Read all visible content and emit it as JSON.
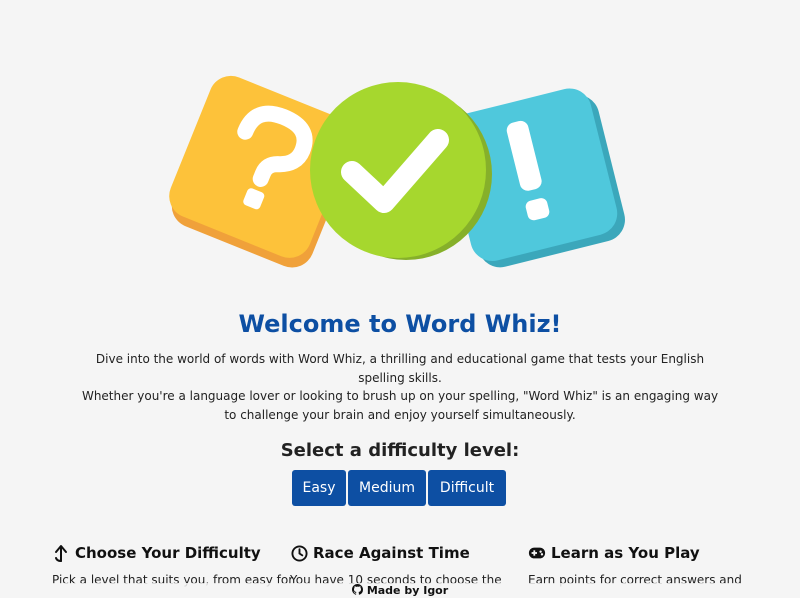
{
  "hero": {
    "icons": [
      "question-mark-icon",
      "check-mark-icon",
      "exclamation-mark-icon"
    ],
    "colors": {
      "question": "#fdc23a",
      "check": "#a6d72e",
      "exclamation": "#4fc8dc"
    }
  },
  "title": "Welcome to Word Whiz!",
  "intro": {
    "line1": "Dive into the world of words with Word Whiz, a thrilling and educational game that tests your English spelling skills.",
    "line2": "Whether you're a language lover or looking to brush up on your spelling, \"Word Whiz\" is an engaging way",
    "line3": "to challenge your brain and enjoy yourself simultaneously."
  },
  "difficulty": {
    "label": "Select a difficulty level:",
    "options": [
      "Easy",
      "Medium",
      "Difficult"
    ]
  },
  "features": [
    {
      "icon": "arrow-up-icon",
      "title": "Choose Your Difficulty",
      "text": "Pick a level that suits you, from easy for"
    },
    {
      "icon": "clock-icon",
      "title": "Race Against Time",
      "text": "You have 10 seconds to choose the"
    },
    {
      "icon": "gamepad-icon",
      "title": "Learn as You Play",
      "text": "Earn points for correct answers and"
    }
  ],
  "footer": {
    "text": "Made by Igor",
    "icon": "github-icon"
  },
  "colors": {
    "accent": "#0d4fa3",
    "background": "#f5f5f5"
  }
}
